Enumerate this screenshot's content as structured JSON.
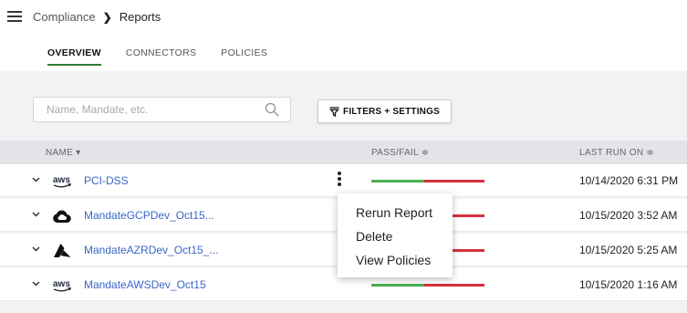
{
  "breadcrumb": {
    "parent": "Compliance",
    "separator": "❯",
    "current": "Reports"
  },
  "tabs": [
    {
      "label": "OVERVIEW",
      "active": true
    },
    {
      "label": "CONNECTORS",
      "active": false
    },
    {
      "label": "POLICIES",
      "active": false
    }
  ],
  "search": {
    "placeholder": "Name, Mandate, etc.",
    "value": ""
  },
  "filters_button": {
    "label": "FILTERS + SETTINGS",
    "icon": "filter-icon"
  },
  "table": {
    "headers": {
      "name": "NAME ▾",
      "pass_fail": "PASS/FAIL ≑",
      "last_run": "LAST RUN ON ≑"
    },
    "rows": [
      {
        "name": "PCI-DSS",
        "provider": "aws",
        "pass_fraction": 0.47,
        "last_run": "10/14/2020 6:31 PM"
      },
      {
        "name": "MandateGCPDev_Oct15...",
        "provider": "gcp",
        "pass_fraction": 0.47,
        "last_run": "10/15/2020 3:52 AM"
      },
      {
        "name": "MandateAZRDev_Oct15_...",
        "provider": "azure",
        "pass_fraction": 0.47,
        "last_run": "10/15/2020 5:25 AM"
      },
      {
        "name": "MandateAWSDev_Oct15",
        "provider": "aws",
        "pass_fraction": 0.47,
        "last_run": "10/15/2020 1:16 AM"
      }
    ]
  },
  "context_menu": {
    "items": [
      "Rerun Report",
      "Delete",
      "View Policies"
    ]
  },
  "colors": {
    "pass": "#4caf50",
    "fail": "#d5313e",
    "link": "#3867c7",
    "active_tab": "#2e7d32"
  },
  "aws_logo_text": "aws"
}
